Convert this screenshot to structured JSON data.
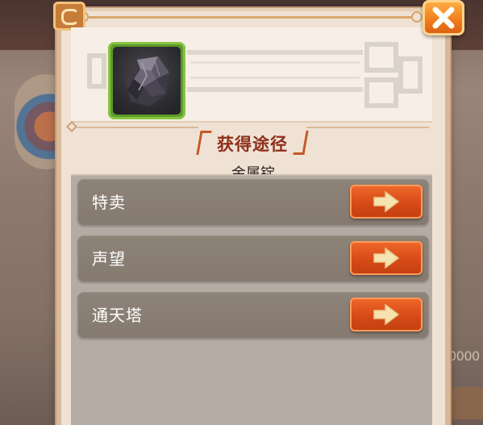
{
  "panel": {
    "section_title": "获得途径",
    "item_name": "金属锭"
  },
  "sources": [
    {
      "label": "特卖"
    },
    {
      "label": "声望"
    },
    {
      "label": "通天塔"
    }
  ],
  "background": {
    "right_number": "0000"
  },
  "icons": {
    "close": "close-x-icon",
    "go": "arrow-right-icon",
    "item": "metal-ingot-icon"
  },
  "colors": {
    "panel_bg": "#efe2d4",
    "row_bg": "#8a7f74",
    "go_button": "#d64a18",
    "item_border": "#86c442",
    "title": "#8e2f1a"
  }
}
